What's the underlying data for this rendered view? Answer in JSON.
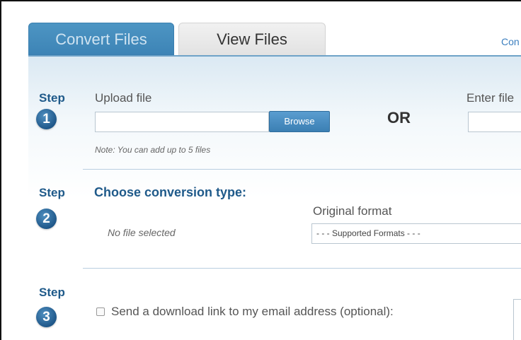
{
  "tabs": {
    "convert_label": "Convert Files",
    "view_label": "View Files"
  },
  "top_link": "Con",
  "step1": {
    "step_word": "Step",
    "number": "1",
    "upload_label": "Upload file",
    "browse_label": "Browse",
    "or_label": "OR",
    "url_label": "Enter file",
    "note": "Note: You can add up to 5 files"
  },
  "step2": {
    "step_word": "Step",
    "number": "2",
    "title": "Choose conversion type:",
    "no_file": "No file selected",
    "original_format_label": "Original format",
    "format_select": "- - - Supported Formats - - -"
  },
  "step3": {
    "step_word": "Step",
    "number": "3",
    "email_checkbox_label": "Send a download link to my email address (optional):"
  }
}
